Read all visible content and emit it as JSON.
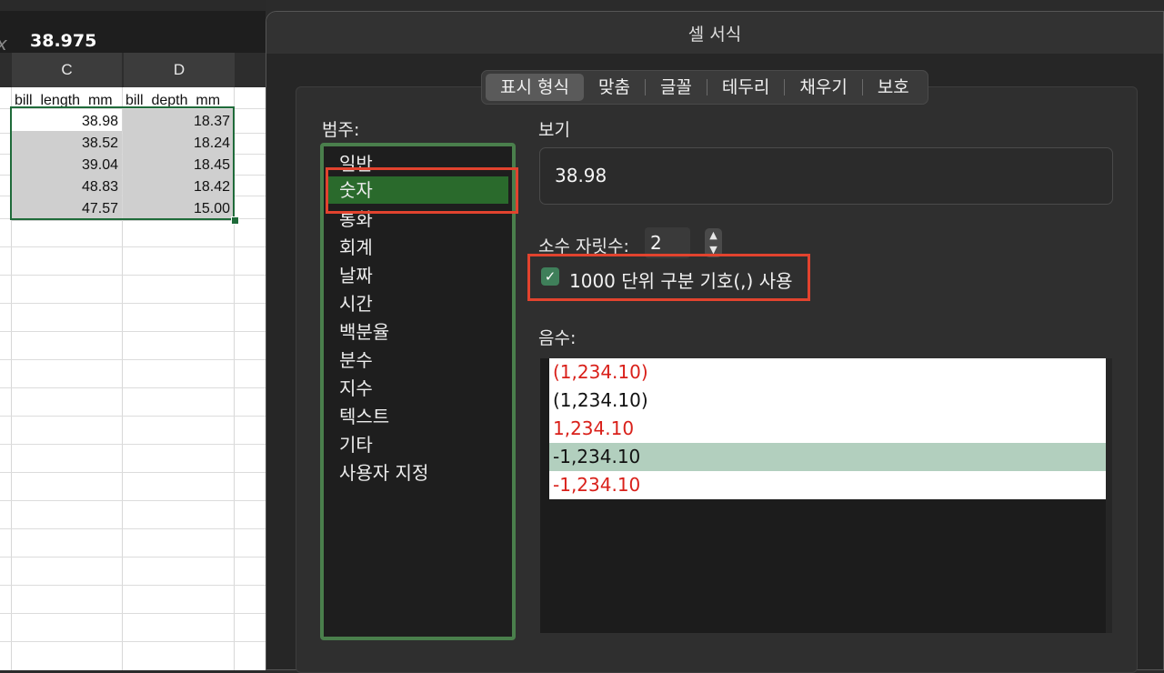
{
  "formula_bar": {
    "fx_symbol": "x",
    "value": "38.975"
  },
  "sheet": {
    "columns": [
      "C",
      "D"
    ],
    "headers": [
      "bill_length_mm",
      "bill_depth_mm"
    ],
    "rows": [
      [
        "38.98",
        "18.37"
      ],
      [
        "38.52",
        "18.24"
      ],
      [
        "39.04",
        "18.45"
      ],
      [
        "48.83",
        "18.42"
      ],
      [
        "47.57",
        "15.00"
      ]
    ]
  },
  "dialog": {
    "title": "셀 서식",
    "tabs": [
      "표시 형식",
      "맞춤",
      "글꼴",
      "테두리",
      "채우기",
      "보호"
    ],
    "active_tab": "표시 형식",
    "category_label": "범주:",
    "categories": [
      "일반",
      "숫자",
      "통화",
      "회계",
      "날짜",
      "시간",
      "백분율",
      "분수",
      "지수",
      "텍스트",
      "기타",
      "사용자 지정"
    ],
    "selected_category": "숫자",
    "preview_label": "보기",
    "preview_value": "38.98",
    "decimal_label": "소수 자릿수:",
    "decimal_value": "2",
    "separator_label": "1000 단위 구분 기호(,) 사용",
    "separator_checked": true,
    "negative_label": "음수:",
    "negative_formats": [
      {
        "text": "(1,234.10)",
        "color": "red"
      },
      {
        "text": "(1,234.10)",
        "color": "black"
      },
      {
        "text": "1,234.10",
        "color": "red"
      },
      {
        "text": "-1,234.10",
        "color": "black",
        "selected": true
      },
      {
        "text": "-1,234.10",
        "color": "red"
      }
    ]
  },
  "colors": {
    "accent_green": "#2a6a2c",
    "highlight_red": "#e2432e",
    "negative_red": "#d9201a"
  }
}
